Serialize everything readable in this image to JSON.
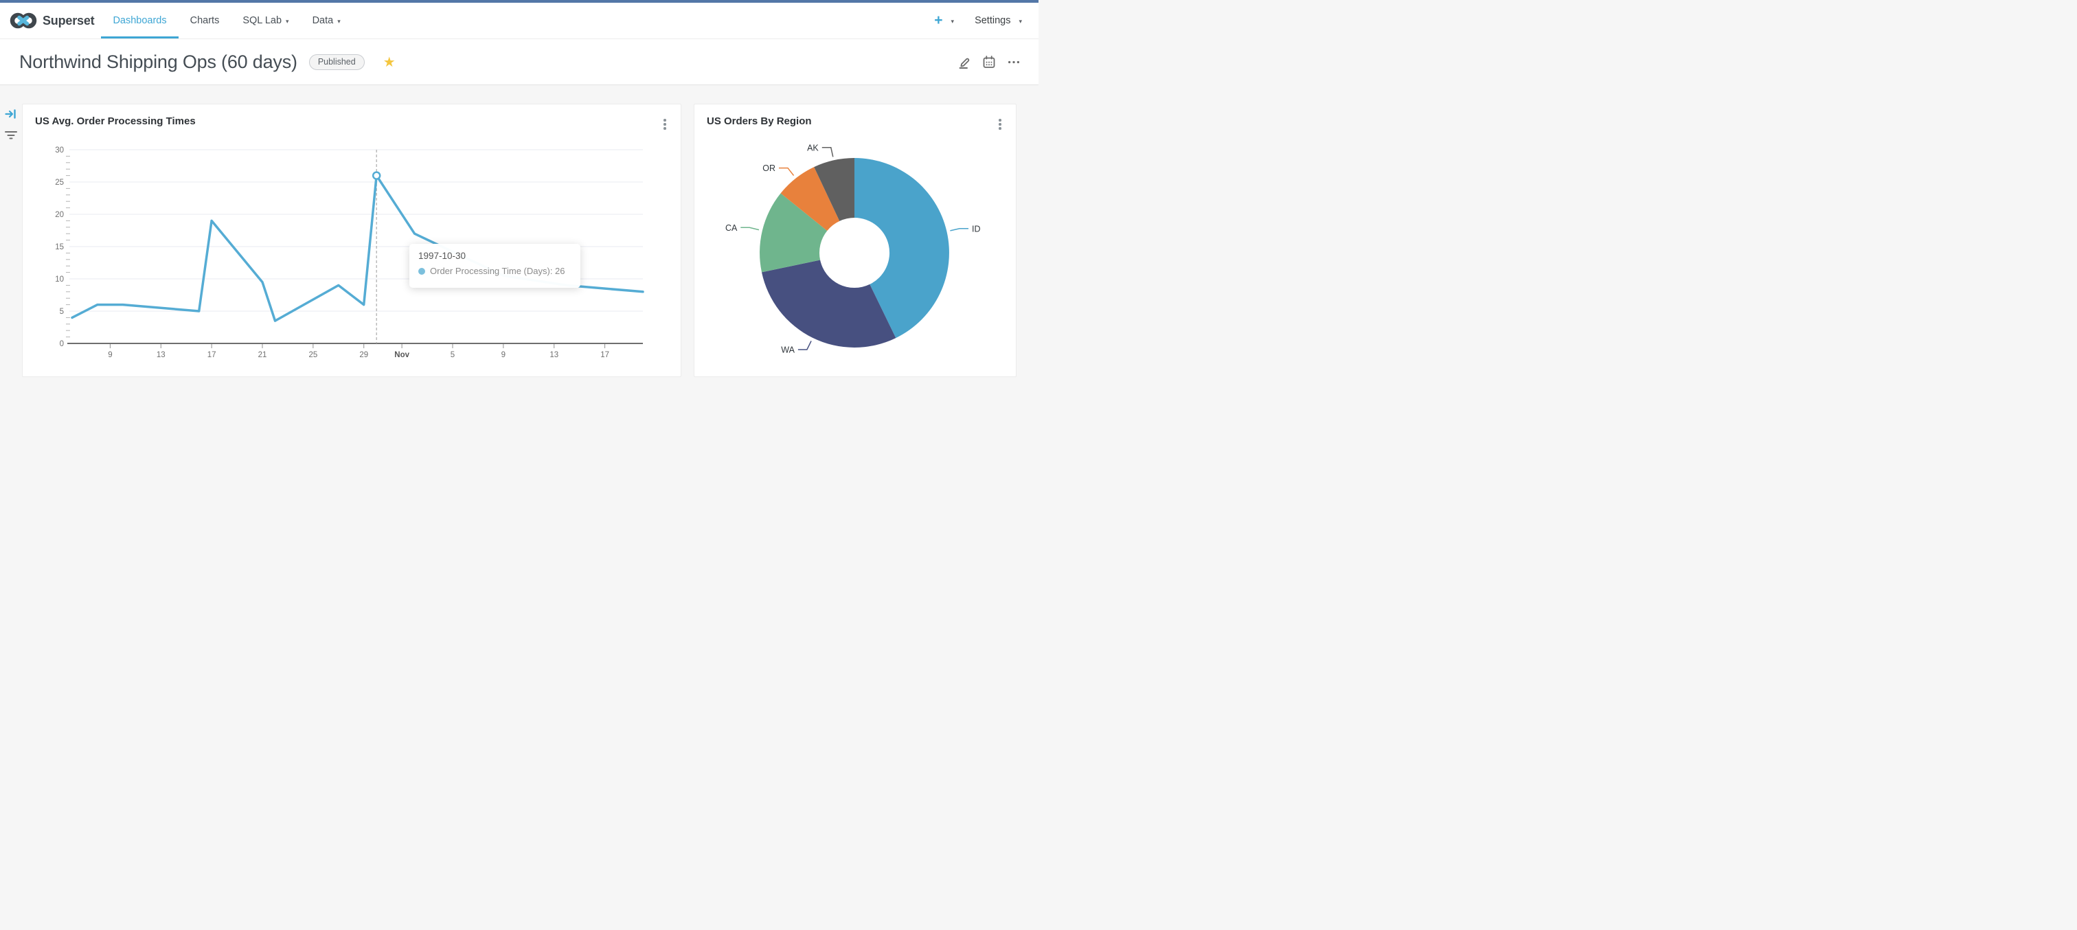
{
  "page": {
    "topstrip_color": "#5377A7",
    "background": "#F6F6F6"
  },
  "navbar": {
    "brand": "Superset",
    "items": [
      {
        "label": "Dashboards",
        "active": true,
        "caret": false
      },
      {
        "label": "Charts",
        "active": false,
        "caret": false
      },
      {
        "label": "SQL Lab",
        "active": false,
        "caret": true
      },
      {
        "label": "Data",
        "active": false,
        "caret": true
      }
    ],
    "new_label": "+",
    "settings_label": "Settings",
    "accent_color": "#3EA6D4"
  },
  "title_bar": {
    "title": "Northwind Shipping Ops (60 days)",
    "badge_label": "Published",
    "star_color": "#F4C63F"
  },
  "chart_data": [
    {
      "type": "line",
      "title": "US Avg. Order Processing Times",
      "series": [
        {
          "name": "Order Processing Time (Days)",
          "color": "#55ACD4",
          "points": [
            [
              "1997-10-06",
              4
            ],
            [
              "1997-10-08",
              6
            ],
            [
              "1997-10-10",
              6
            ],
            [
              "1997-10-16",
              5
            ],
            [
              "1997-10-17",
              19
            ],
            [
              "1997-10-21",
              9.5
            ],
            [
              "1997-10-22",
              3.5
            ],
            [
              "1997-10-27",
              9
            ],
            [
              "1997-10-29",
              6
            ],
            [
              "1997-10-30",
              26
            ],
            [
              "1997-11-02",
              17
            ],
            [
              "1997-11-09",
              10.5
            ],
            [
              "1997-11-14",
              9
            ],
            [
              "1997-11-20",
              8
            ]
          ]
        }
      ],
      "x_domain": [
        "1997-10-06",
        "1997-11-20"
      ],
      "x_ticks": [
        {
          "label": "9",
          "date": "1997-10-09"
        },
        {
          "label": "13",
          "date": "1997-10-13"
        },
        {
          "label": "17",
          "date": "1997-10-17"
        },
        {
          "label": "21",
          "date": "1997-10-21"
        },
        {
          "label": "25",
          "date": "1997-10-25"
        },
        {
          "label": "29",
          "date": "1997-10-29"
        },
        {
          "label": "Nov",
          "date": "1997-11-01",
          "bold": true
        },
        {
          "label": "5",
          "date": "1997-11-05"
        },
        {
          "label": "9",
          "date": "1997-11-09"
        },
        {
          "label": "13",
          "date": "1997-11-13"
        },
        {
          "label": "17",
          "date": "1997-11-17"
        }
      ],
      "y_ticks": [
        0,
        5,
        10,
        15,
        20,
        25,
        30
      ],
      "ylim": [
        0,
        30
      ],
      "grid": true,
      "crosshair_date": "1997-10-30",
      "highlight": {
        "date": "1997-10-30",
        "value": 26
      },
      "tooltip": {
        "title": "1997-10-30",
        "line": "Order Processing Time (Days): 26",
        "dot_color": "#7CC0DD"
      }
    },
    {
      "type": "donut",
      "title": "US Orders By Region",
      "labels": [
        "ID",
        "WA",
        "CA",
        "OR",
        "AK"
      ],
      "values": [
        42.8,
        28.9,
        14.1,
        7.2,
        7.0
      ],
      "colors": [
        "#4AA3CB",
        "#475080",
        "#6FB58D",
        "#E8813C",
        "#606060"
      ],
      "legend": "none",
      "label_position": "outside"
    }
  ]
}
